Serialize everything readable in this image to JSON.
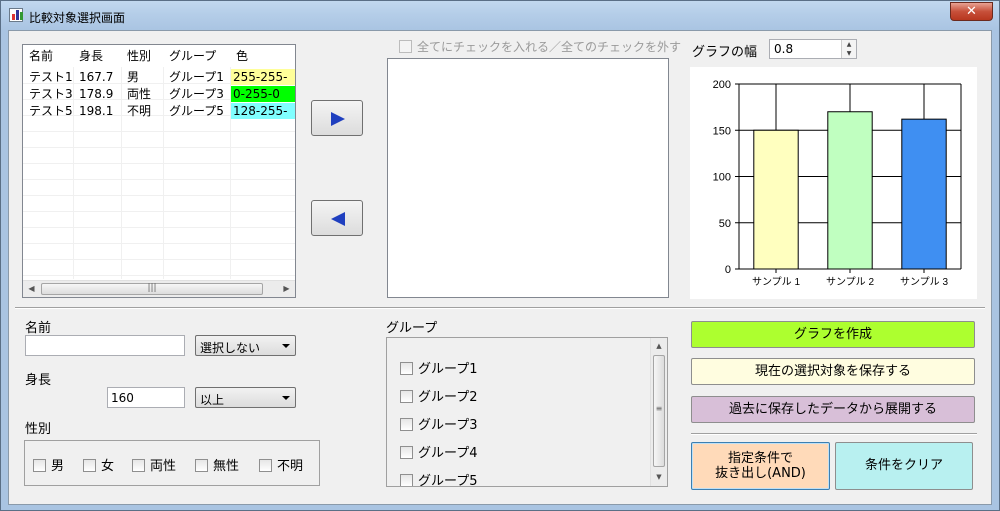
{
  "window": {
    "title": "比較対象選択画面",
    "close_label": "✕"
  },
  "result_list": {
    "columns": [
      "名前",
      "身長",
      "性別",
      "グループ",
      "色"
    ],
    "rows": [
      {
        "name": "テスト1",
        "height": "167.7",
        "gender": "男",
        "group": "グループ1",
        "color_text": "255-255-",
        "color_bg": "#ffff99"
      },
      {
        "name": "テスト3",
        "height": "178.9",
        "gender": "両性",
        "group": "グループ3",
        "color_text": "0-255-0",
        "color_bg": "#00ff00"
      },
      {
        "name": "テスト5",
        "height": "198.1",
        "gender": "不明",
        "group": "グループ5",
        "color_text": "128-255-",
        "color_bg": "#80ffff"
      }
    ],
    "scroll_grip": "|||"
  },
  "transfer": {
    "add_icon": "play-right-icon",
    "remove_icon": "play-left-icon"
  },
  "selection": {
    "check_all_label": "全てにチェックを入れる／全てのチェックを外す"
  },
  "graph_width": {
    "label": "グラフの幅",
    "value": "0.8"
  },
  "chart_data": {
    "type": "bar",
    "categories": [
      "サンプル 1",
      "サンプル 2",
      "サンプル 3"
    ],
    "values": [
      150,
      170,
      162
    ],
    "colors": [
      "#ffffbf",
      "#c0ffc0",
      "#3f8ff2"
    ],
    "y_ticks": [
      "0",
      "50",
      "100",
      "150",
      "200"
    ],
    "ylim": [
      0,
      200
    ],
    "grid": true,
    "title": "",
    "xlabel": "",
    "ylabel": ""
  },
  "filters": {
    "name_label": "名前",
    "name_value": "",
    "name_mode": "選択しない",
    "height_label": "身長",
    "height_value": "160",
    "height_mode": "以上",
    "gender_label": "性別",
    "genders": [
      "男",
      "女",
      "両性",
      "無性",
      "不明"
    ],
    "group_label": "グループ",
    "groups": [
      "グループ1",
      "グループ2",
      "グループ3",
      "グループ4",
      "グループ5"
    ]
  },
  "actions": {
    "create_graph": "グラフを作成",
    "save_selection": "現在の選択対象を保存する",
    "load_saved": "過去に保存したデータから展開する",
    "extract_line1": "指定条件で",
    "extract_line2": "抜き出し(AND)",
    "clear": "条件をクリア"
  },
  "colors": {
    "create_graph_bg": "#adff2f",
    "save_bg": "#fffde0",
    "load_bg": "#d8bfd8",
    "extract_bg": "#ffdab9",
    "clear_bg": "#b8f0f0"
  }
}
